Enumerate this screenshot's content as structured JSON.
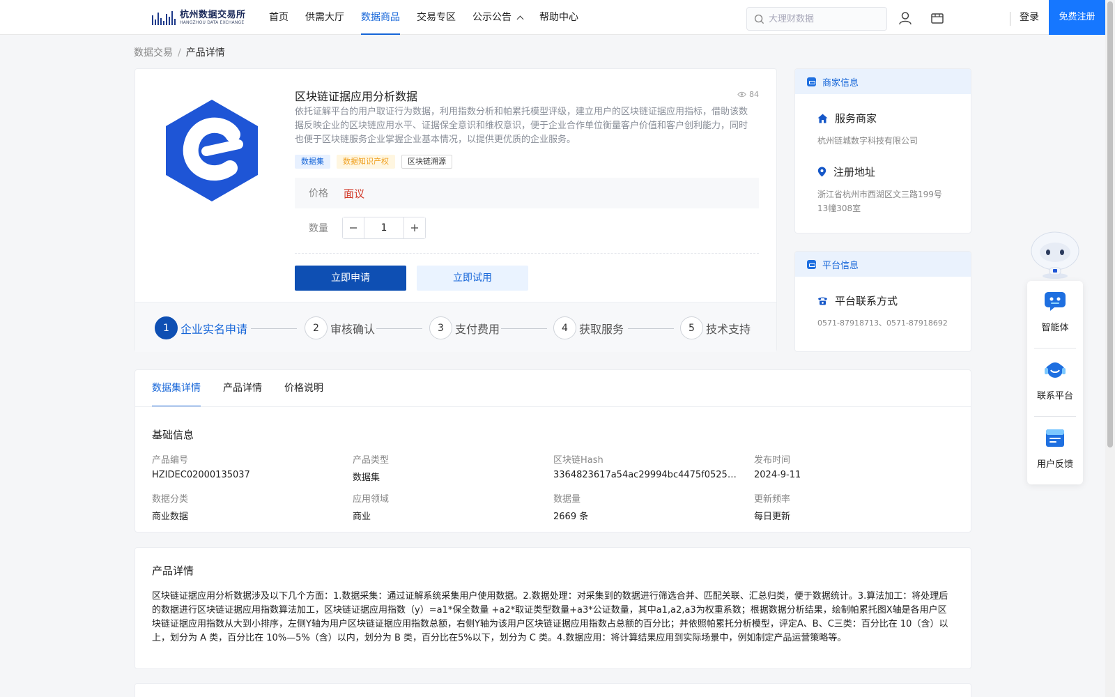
{
  "header": {
    "logo_cn": "杭州数据交易所",
    "logo_en": "HANGZHOU DATA EXCHANGE",
    "nav": [
      {
        "label": "首页"
      },
      {
        "label": "供需大厅"
      },
      {
        "label": "数据商品"
      },
      {
        "label": "交易专区"
      },
      {
        "label": "公示公告"
      },
      {
        "label": "帮助中心"
      }
    ],
    "active_nav": "数据商品",
    "search_placeholder": "大理财数据",
    "login_label": "登录",
    "register_label": "免费注册",
    "accent_color": "#1677ff"
  },
  "breadcrumb": {
    "root": "数据交易",
    "separator": "/",
    "current": "产品详情"
  },
  "product": {
    "title": "区块链证据应用分析数据",
    "views": "84",
    "description": "依托证解平台的用户取证行为数据，利用指数分析和帕累托模型评级，建立用户的区块链证据应用指标，借助该数据反映企业的区块链应用水平、证据保全意识和维权意识，便于企业合作单位衡量客户价值和客户创利能力，同时也便于区块链服务企业掌握企业基本情况，以提供更优质的企业服务。",
    "tags": [
      "数据集",
      "数据知识产权",
      "区块链溯源"
    ],
    "price_label": "价格",
    "price_value": "面议",
    "qty_label": "数量",
    "qty_value": "1",
    "apply_label": "立即申请",
    "trial_label": "立即试用",
    "brand_color": "#1e55d6"
  },
  "steps": [
    {
      "num": "1",
      "label": "企业实名申请"
    },
    {
      "num": "2",
      "label": "审核确认"
    },
    {
      "num": "3",
      "label": "支付费用"
    },
    {
      "num": "4",
      "label": "获取服务"
    },
    {
      "num": "5",
      "label": "技术支持"
    }
  ],
  "merchant": {
    "head": "商家信息",
    "service_label": "服务商家",
    "service_value": "杭州链城数字科技有限公司",
    "addr_label": "注册地址",
    "addr_value": "浙江省杭州市西湖区文三路199号13幢308室"
  },
  "platform": {
    "head": "平台信息",
    "contact_label": "平台联系方式",
    "contact_value": "0571-87918713、0571-87918692"
  },
  "float": {
    "items": [
      {
        "label": "智能体",
        "icon": "chat-bot-icon"
      },
      {
        "label": "联系平台",
        "icon": "headset-icon"
      },
      {
        "label": "用户反馈",
        "icon": "feedback-icon"
      }
    ]
  },
  "details": {
    "tabs": [
      "数据集详情",
      "产品详情",
      "价格说明"
    ],
    "section_title": "基础信息",
    "fields": [
      {
        "k": "产品编号",
        "v": "HZIDEC02000135037"
      },
      {
        "k": "产品类型",
        "v": "数据集"
      },
      {
        "k": "区块链Hash",
        "v": "3364823617a54ac29994bc4475f05259e4..."
      },
      {
        "k": "发布时间",
        "v": "2024-9-11"
      },
      {
        "k": "数据分类",
        "v": "商业数据"
      },
      {
        "k": "应用领域",
        "v": "商业"
      },
      {
        "k": "数据量",
        "v": "2669 条"
      },
      {
        "k": "更新频率",
        "v": "每日更新"
      }
    ]
  },
  "info": {
    "title": "产品详情",
    "text": "区块链证据应用分析数据涉及以下几个方面：1.数据采集：通过证解系统采集用户使用数据。2.数据处理：对采集到的数据进行筛选合并、匹配关联、汇总归类，便于数据统计。3.算法加工：将处理后的数据进行区块链证据应用指数算法加工，区块链证据应用指数（y）=a1*保全数量 +a2*取证类型数量+a3*公证数量，其中a1,a2,a3为权重系数；根据数据分析结果，绘制帕累托图X轴是各用户区块链证据应用指数从大到小排序，左侧Y轴为用户区块链证据应用指数总额，右侧Y轴为该用户区块链证据应用指数占总额的百分比；并依照帕累托分析模型，评定A、B、C三类：百分比在 10（含）以上，划分为 A 类，百分比在 10%—5%（含）以内，划分为 B 类，百分比在5%以下，划分为 C 类。4.数据应用：将计算结果应用到实际场景中，例如制定产品运营策略等。"
  }
}
